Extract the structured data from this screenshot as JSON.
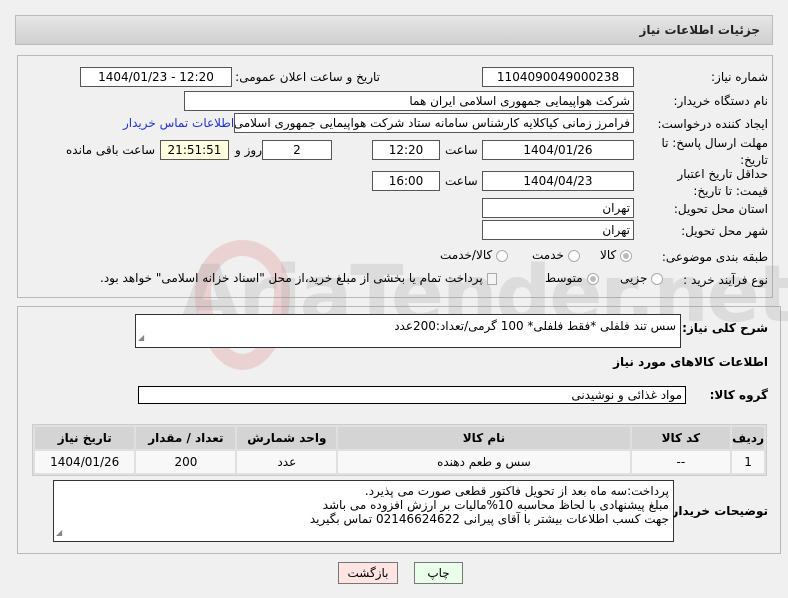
{
  "header": {
    "title": "جزئیات اطلاعات نیاز"
  },
  "form": {
    "need_number_label": "شماره نیاز:",
    "need_number": "1104090049000238",
    "announce_label": "تاریخ و ساعت اعلان عمومی:",
    "announce_value": "1404/01/23 - 12:20",
    "buyer_org_label": "نام دستگاه خریدار:",
    "buyer_org": "شرکت هواپیمایی جمهوری اسلامی ایران هما",
    "creator_label": "ایجاد کننده درخواست:",
    "creator": "فرامرز زمانی کیاکلایه کارشناس سامانه ستاد شرکت هواپیمایی جمهوری اسلامی ایران هما",
    "contact_link": "اطلاعات تماس خریدار",
    "deadline_label": "مهلت ارسال پاسخ: تا تاریخ:",
    "deadline_date": "1404/01/26",
    "time_label": "ساعت",
    "deadline_time": "12:20",
    "days": "2",
    "days_label": "روز و",
    "remaining": "21:51:51",
    "remaining_label": "ساعت باقی مانده",
    "validity_label": "حداقل تاریخ اعتبار قیمت: تا تاریخ:",
    "validity_date": "1404/04/23",
    "validity_time": "16:00",
    "province_label": "استان محل تحویل:",
    "province": "تهران",
    "city_label": "شهر محل تحویل:",
    "city": "تهران",
    "category_label": "طبقه بندی موضوعی:",
    "category_options": [
      "کالا",
      "خدمت",
      "کالا/خدمت"
    ],
    "process_label": "نوع فرآیند خرید :",
    "process_options": [
      "جزیی",
      "متوسط"
    ],
    "payment_note": "پرداخت تمام یا بخشی از مبلغ خرید،از محل \"اسناد خزانه اسلامی\" خواهد بود."
  },
  "details": {
    "desc_label": "شرح کلی نیاز:",
    "desc": "سس تند فلفلی *فقط فلفلی* 100 گرمی/تعداد:200عدد",
    "goods_title": "اطلاعات کالاهای مورد نیاز",
    "group_label": "گروه کالا:",
    "group": "مواد غذائی و نوشیدنی",
    "table": {
      "headers": [
        "ردیف",
        "کد کالا",
        "نام کالا",
        "واحد شمارش",
        "تعداد / مقدار",
        "تاریخ نیاز"
      ],
      "rows": [
        [
          "1",
          "--",
          "سس و طعم دهنده",
          "عدد",
          "200",
          "1404/01/26"
        ]
      ]
    },
    "notes_label": "توضیحات خریدار:",
    "notes": [
      "پرداخت:سه ماه بعد از تحویل فاکتور قطعی صورت می پذیرد.",
      "مبلغ پیشنهادی با لحاظ محاسبه 10%مالیات بر ارزش افزوده می باشد",
      "جهت کسب اطلاعات بیشتر با آقای پیرانی 02146624622 تماس بگیرید"
    ]
  },
  "buttons": {
    "back": "بازگشت",
    "print": "چاپ"
  },
  "watermark": "AriaTender.net"
}
